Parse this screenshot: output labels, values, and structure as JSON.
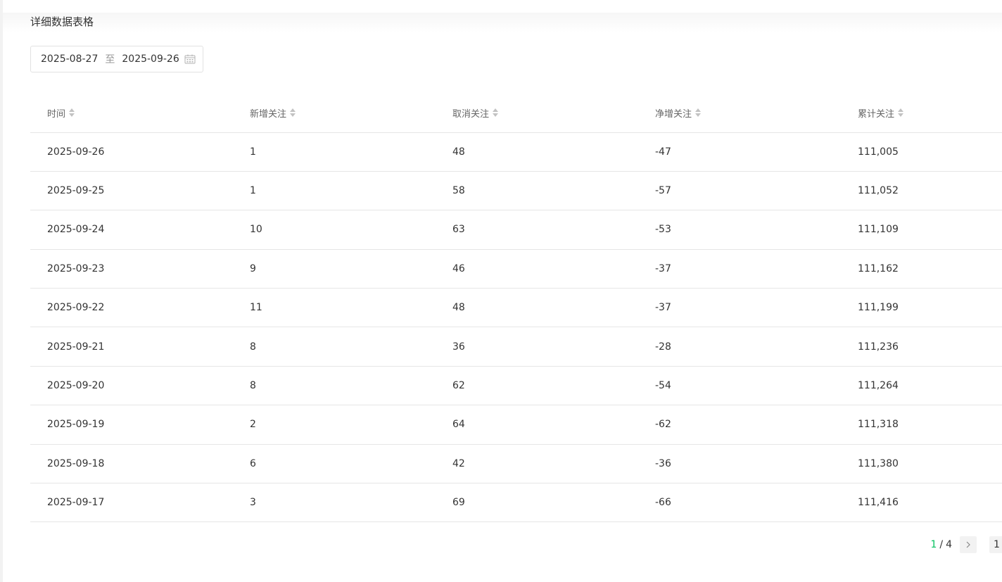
{
  "section": {
    "title": "详细数据表格"
  },
  "date_range": {
    "start": "2025-08-27",
    "separator": "至",
    "end": "2025-09-26",
    "icon": "calendar-icon"
  },
  "table": {
    "columns": [
      "时间",
      "新增关注",
      "取消关注",
      "净增关注",
      "累计关注"
    ],
    "rows": [
      [
        "2025-09-26",
        "1",
        "48",
        "-47",
        "111,005"
      ],
      [
        "2025-09-25",
        "1",
        "58",
        "-57",
        "111,052"
      ],
      [
        "2025-09-24",
        "10",
        "63",
        "-53",
        "111,109"
      ],
      [
        "2025-09-23",
        "9",
        "46",
        "-37",
        "111,162"
      ],
      [
        "2025-09-22",
        "11",
        "48",
        "-37",
        "111,199"
      ],
      [
        "2025-09-21",
        "8",
        "36",
        "-28",
        "111,236"
      ],
      [
        "2025-09-20",
        "8",
        "62",
        "-54",
        "111,264"
      ],
      [
        "2025-09-19",
        "2",
        "64",
        "-62",
        "111,318"
      ],
      [
        "2025-09-18",
        "6",
        "42",
        "-36",
        "111,380"
      ],
      [
        "2025-09-17",
        "3",
        "69",
        "-66",
        "111,416"
      ]
    ]
  },
  "pagination": {
    "current": "1",
    "separator": "/",
    "total": "4",
    "page_input_value": "1",
    "accent_color": "#07c160"
  }
}
